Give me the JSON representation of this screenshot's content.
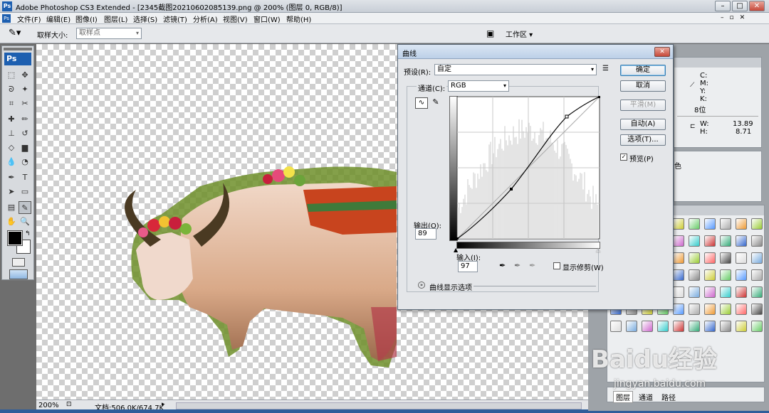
{
  "window": {
    "title": "Adobe Photoshop CS3 Extended - [2345截图20210602085139.png @ 200% (图层 0, RGB/8)]"
  },
  "menu": [
    "文件(F)",
    "编辑(E)",
    "图像(I)",
    "图层(L)",
    "选择(S)",
    "滤镜(T)",
    "分析(A)",
    "视图(V)",
    "窗口(W)",
    "帮助(H)"
  ],
  "options": {
    "sample_size_label": "取样大小:",
    "sample_size_value": "取样点",
    "workspace_label": "工作区"
  },
  "status": {
    "zoom": "200%",
    "doc": "文档:506.0K/674.7K"
  },
  "dialog": {
    "title": "曲线",
    "preset_label": "预设(R):",
    "preset_value": "自定",
    "channel_label": "通道(C):",
    "channel_value": "RGB",
    "output_label": "输出(O):",
    "output_value": "89",
    "input_label": "输入(I):",
    "input_value": "97",
    "show_clipping": "显示修剪(W)",
    "curve_display_options": "曲线显示选项",
    "buttons": {
      "ok": "确定",
      "cancel": "取消",
      "smooth": "平滑(M)",
      "auto": "自动(A)",
      "options": "选项(T)...",
      "preview": "预览(P)"
    }
  },
  "info_panel": {
    "c": "C:",
    "m": "M:",
    "y": "Y:",
    "k": "K:",
    "bits": "8位",
    "w_label": "W:",
    "w_value": "13.89",
    "h_label": "H:",
    "h_value": "8.71",
    "frag": "色"
  },
  "layers_tabs": [
    "图层",
    "通道",
    "路径"
  ],
  "watermark": "Baidu经验",
  "watermark_url": "jingyan.baidu.com",
  "colors": {
    "accent": "#316ac5",
    "fg_swatch": "#000000",
    "bg_swatch": "#ffffff"
  }
}
